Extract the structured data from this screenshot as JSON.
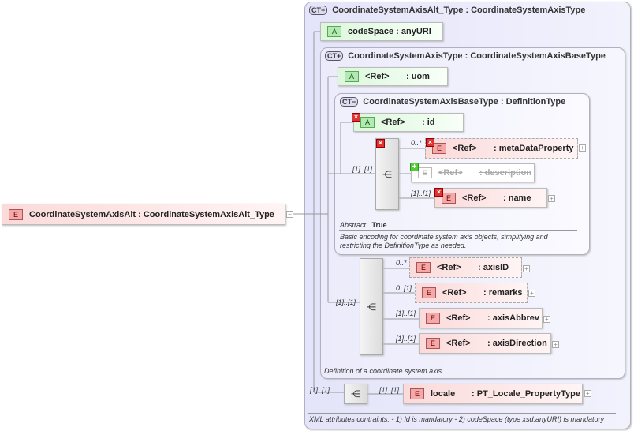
{
  "root": {
    "badge": "E",
    "label": "CoordinateSystemAxisAlt : CoordinateSystemAxisAlt_Type"
  },
  "outer": {
    "badge": "CT+",
    "title": "CoordinateSystemAxisAlt_Type : CoordinateSystemAxisType",
    "note": "XML attributes contraints: - 1) Id is mandatory - 2) codeSpace (type xsd:anyURI) is mandatory"
  },
  "codeSpace": {
    "badge": "A",
    "label": "codeSpace : anyURI"
  },
  "mid": {
    "badge": "CT+",
    "title": "CoordinateSystemAxisType : CoordinateSystemAxisBaseType",
    "note": "Definition of a coordinate system axis."
  },
  "uom": {
    "badge": "A",
    "ref": "<Ref>",
    "name": ": uom"
  },
  "base": {
    "badge": "CT−",
    "title": "CoordinateSystemAxisBaseType : DefinitionType",
    "abstract_label": "Abstract",
    "abstract_value": "True",
    "note1": "Basic encoding for coordinate system axis objects, simplifying and",
    "note2": "restricting the DefinitionType as needed."
  },
  "id": {
    "badge": "A",
    "ref": "<Ref>",
    "name": ": id"
  },
  "seq1": {
    "card": "[1]..[1]"
  },
  "metaDataProperty": {
    "badge": "E",
    "ref": "<Ref>",
    "name": ": metaDataProperty",
    "card": "0..*"
  },
  "description": {
    "badge": "E",
    "ref": "<Ref>",
    "name": ": description"
  },
  "name": {
    "badge": "E",
    "ref": "<Ref>",
    "name": ": name",
    "card": "[1]..[1]"
  },
  "seq2": {
    "card": "[1]..[1]"
  },
  "axisID": {
    "badge": "E",
    "ref": "<Ref>",
    "name": ": axisID",
    "card": "0..*"
  },
  "remarks": {
    "badge": "E",
    "ref": "<Ref>",
    "name": ": remarks",
    "card": "0..[1]"
  },
  "axisAbbrev": {
    "badge": "E",
    "ref": "<Ref>",
    "name": ": axisAbbrev",
    "card": "[1]..[1]"
  },
  "axisDirection": {
    "badge": "E",
    "ref": "<Ref>",
    "name": ": axisDirection",
    "card": "[1]..[1]"
  },
  "seq3": {
    "card": "[1]..[1]"
  },
  "locale": {
    "badge": "E",
    "ref": "locale",
    "name": ": PT_Locale_PropertyType",
    "card": "[1]..[1]"
  },
  "icons": {
    "sequence": "sequence-icon",
    "plus": "expand-icon",
    "remove": "prohibited-icon",
    "add": "added-icon"
  }
}
